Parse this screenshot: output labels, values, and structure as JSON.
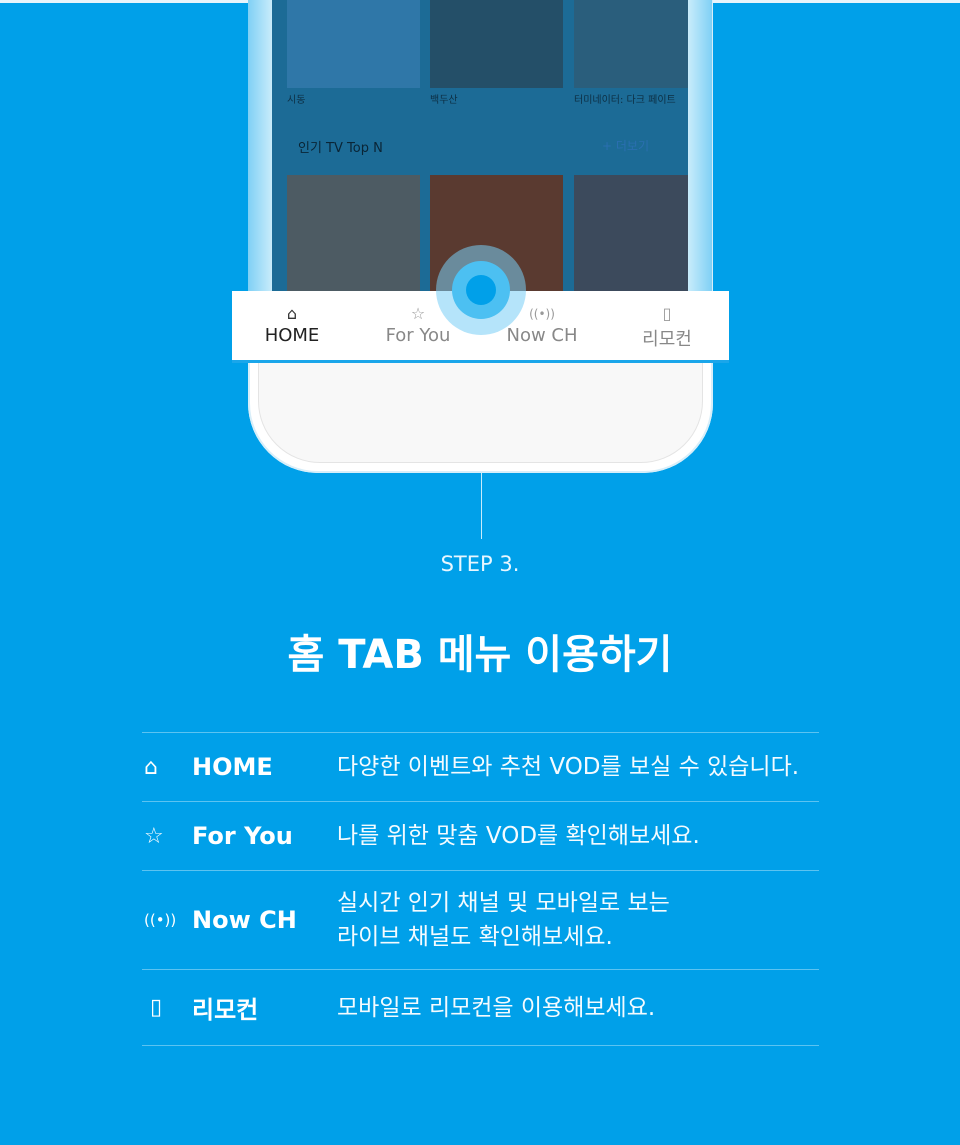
{
  "phone": {
    "movies": [
      "시동",
      "백두산",
      "터미네이터: 다크 페이트"
    ],
    "section_title": "인기 TV Top N",
    "more_label": "+ 더보기",
    "tabs": [
      {
        "label": "HOME",
        "icon": "home-icon",
        "active": true
      },
      {
        "label": "For You",
        "icon": "star-icon",
        "active": false
      },
      {
        "label": "Now CH",
        "icon": "broadcast-icon",
        "active": false
      },
      {
        "label": "리모컨",
        "icon": "remote-icon",
        "active": false
      }
    ]
  },
  "step": "STEP 3.",
  "title": "홈 TAB 메뉴 이용하기",
  "items": [
    {
      "name": "HOME",
      "icon": "home-icon",
      "desc": "다양한 이벤트와 추천 VOD를 보실 수 있습니다."
    },
    {
      "name": "For You",
      "icon": "star-icon",
      "desc": "나를 위한 맞춤 VOD를 확인해보세요."
    },
    {
      "name": "Now CH",
      "icon": "broadcast-icon",
      "desc1": "실시간 인기 채널 및 모바일로 보는",
      "desc2": "라이브 채널도 확인해보세요."
    },
    {
      "name": "리모컨",
      "icon": "remote-icon",
      "desc": "모바일로 리모컨을 이용해보세요."
    }
  ],
  "colors": {
    "background": "#00a0e9",
    "accent": "#4cc0f2"
  }
}
